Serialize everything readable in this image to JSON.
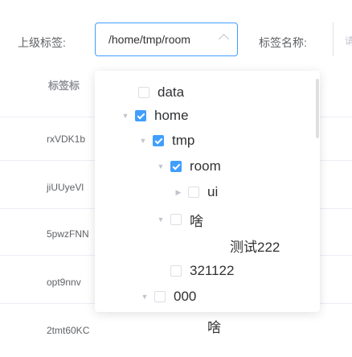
{
  "filter": {
    "parent_label": "上级标签:",
    "selected_path": "/home/tmp/room",
    "name_label": "标签名称:",
    "name_placeholder": "请"
  },
  "table": {
    "column_header": "标签标",
    "rows": [
      "rxVDK1b",
      "jiUUyeVl",
      "5pwzFNN",
      "opt9nnv",
      "2tmt60KC"
    ]
  },
  "tree": {
    "nodes": [
      {
        "label": "data",
        "expandable": false,
        "checked": false
      },
      {
        "label": "home",
        "expandable": true,
        "checked": true
      },
      {
        "label": "tmp",
        "expandable": true,
        "checked": true
      },
      {
        "label": "room",
        "expandable": true,
        "checked": true
      },
      {
        "label": "ui",
        "expandable": true,
        "checked": false
      },
      {
        "label": "啥",
        "expandable": true,
        "checked": false
      },
      {
        "label": "测试222",
        "expandable": false,
        "checked": false
      },
      {
        "label": "321122",
        "expandable": false,
        "checked": false
      },
      {
        "label": "000",
        "expandable": true,
        "checked": false
      },
      {
        "label": "啥",
        "expandable": false,
        "checked": false
      }
    ]
  },
  "colors": {
    "accent": "#409eff",
    "text_primary": "#303133",
    "text_regular": "#606266"
  }
}
